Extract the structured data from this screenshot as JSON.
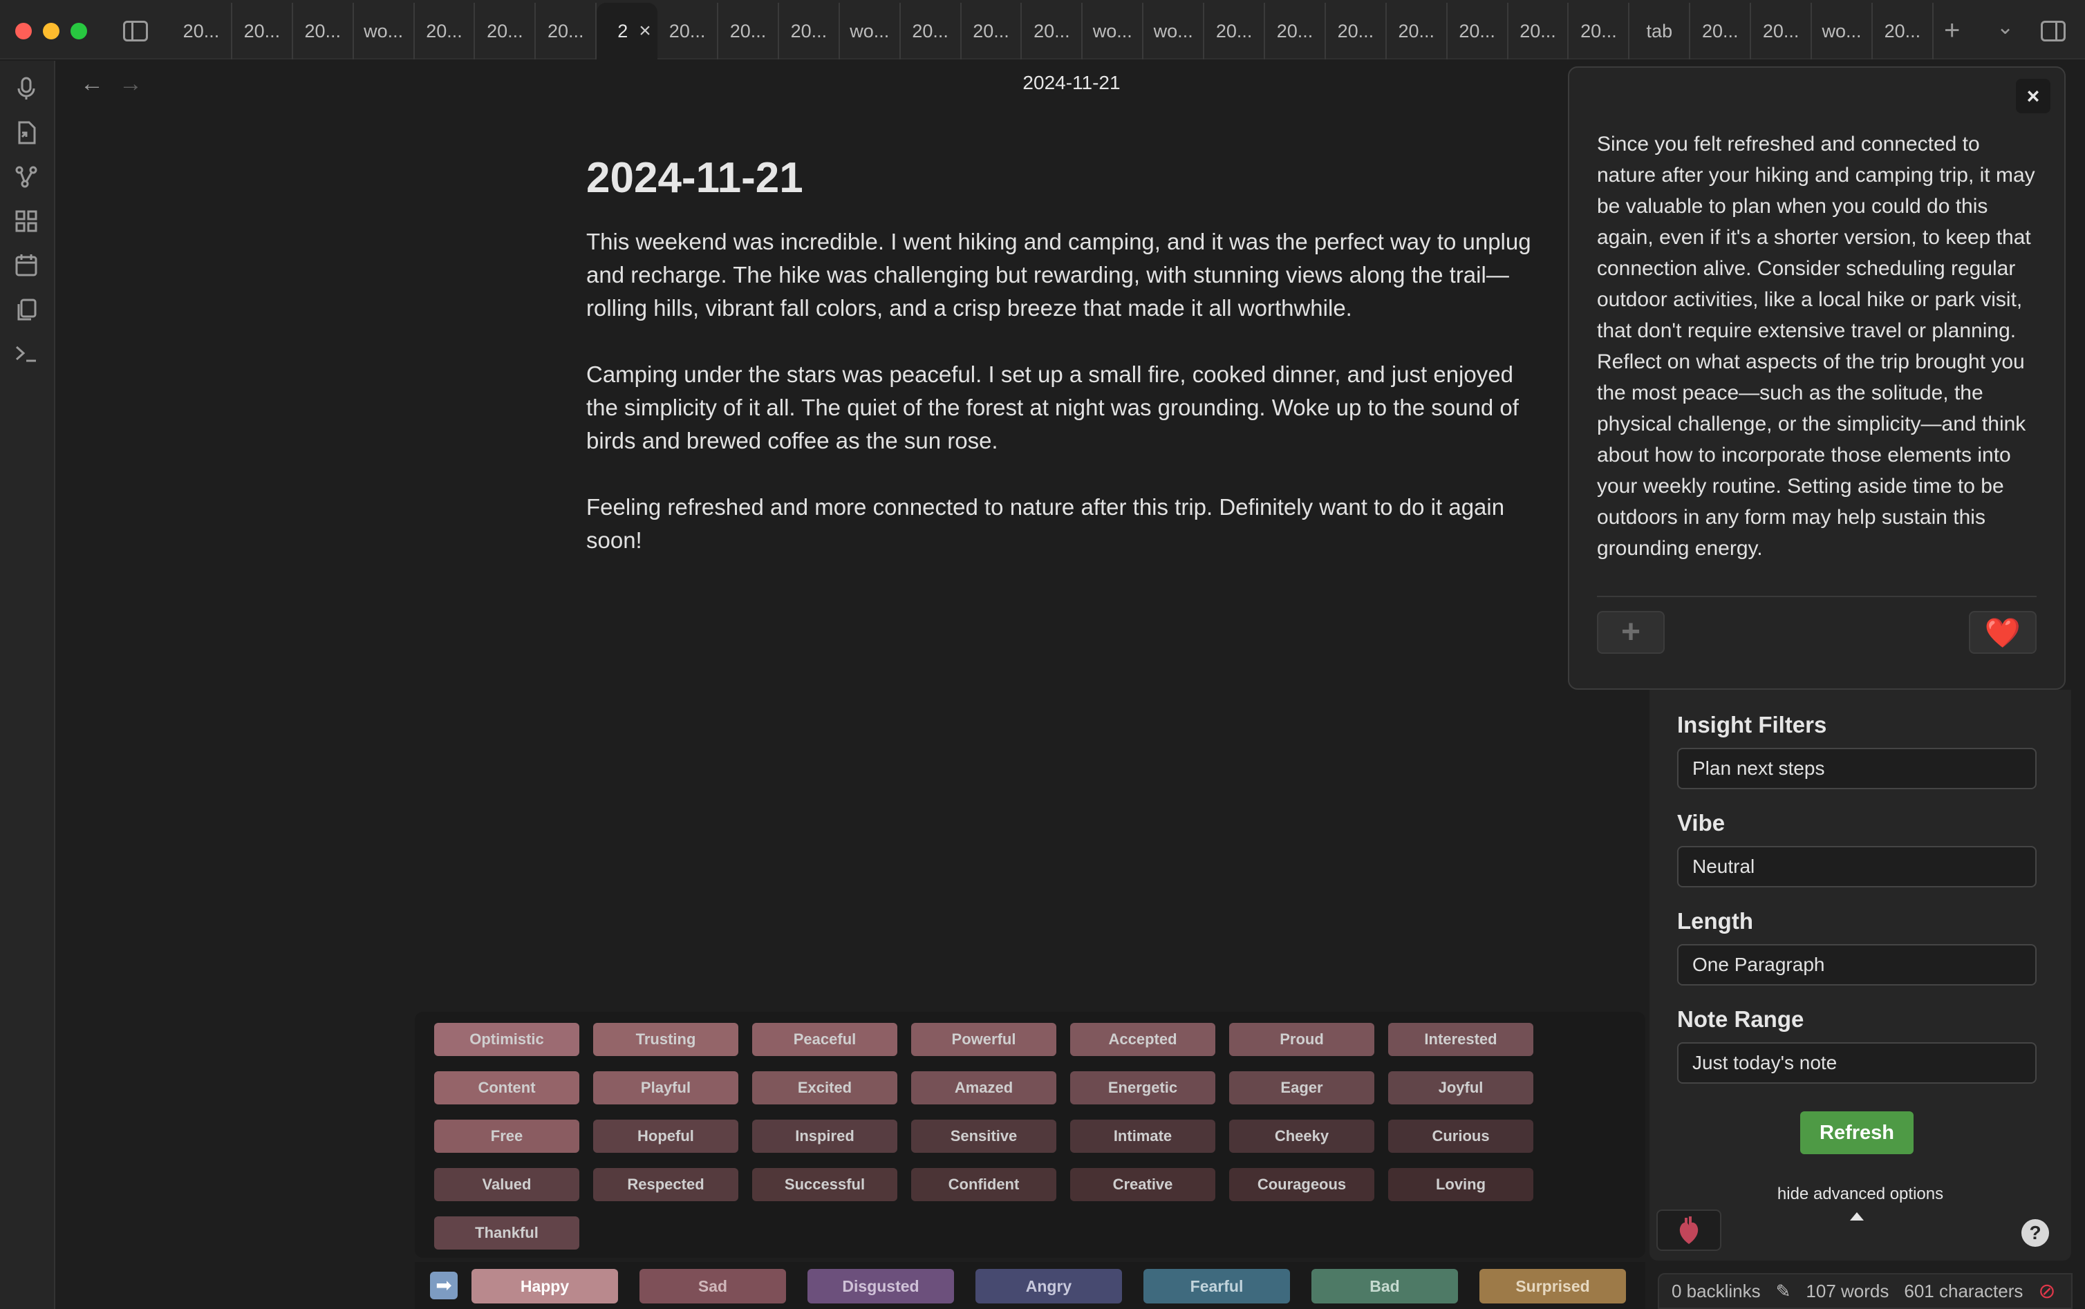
{
  "tabs": [
    "20...",
    "20...",
    "20...",
    "wo...",
    "20...",
    "20...",
    "20...",
    "2",
    "20...",
    "20...",
    "20...",
    "wo...",
    "20...",
    "20...",
    "20...",
    "wo...",
    "wo...",
    "20...",
    "20...",
    "20...",
    "20...",
    "20...",
    "20...",
    "20...",
    "tab",
    "20...",
    "20...",
    "wo...",
    "20..."
  ],
  "active_tab_index": 7,
  "view_title": "2024-11-21",
  "note": {
    "title": "2024-11-21",
    "paragraphs": [
      "This weekend was incredible. I went hiking and camping, and it was the perfect way to unplug and recharge. The hike was challenging but rewarding, with stunning views along the trail—rolling hills, vibrant fall colors, and a crisp breeze that made it all worthwhile.",
      "Camping under the stars was peaceful. I set up a small fire, cooked dinner, and just enjoyed the simplicity of it all. The quiet of the forest at night was grounding. Woke up to the sound of birds and brewed coffee as the sun rose.",
      "Feeling refreshed and more connected to nature after this trip. Definitely want to do it again soon!"
    ]
  },
  "insight": {
    "text": "Since you felt refreshed and connected to nature after your hiking and camping trip, it may be valuable to plan when you could do this again, even if it's a shorter version, to keep that connection alive. Consider scheduling regular outdoor activities, like a local hike or park visit, that don't require extensive travel or planning. Reflect on what aspects of the trip brought you the most peace—such as the solitude, the physical challenge, or the simplicity—and think about how to incorporate those elements into your weekly routine. Setting aside time to be outdoors in any form may help sustain this grounding energy.",
    "close_label": "×",
    "add_label": "+",
    "heart_label": "❤️"
  },
  "panel": {
    "insight_filters_label": "Insight Filters",
    "insight_filters_value": "Plan next steps",
    "vibe_label": "Vibe",
    "vibe_value": "Neutral",
    "length_label": "Length",
    "length_value": "One Paragraph",
    "note_range_label": "Note Range",
    "note_range_value": "Just today's note",
    "refresh_label": "Refresh",
    "hide_advanced_label": "hide advanced options",
    "help_label": "?"
  },
  "status": {
    "backlinks": "0 backlinks",
    "words": "107 words",
    "characters": "601 characters"
  },
  "emotions": [
    {
      "label": "Optimistic",
      "color": "#9c6b72"
    },
    {
      "label": "Trusting",
      "color": "#946569"
    },
    {
      "label": "Peaceful",
      "color": "#8e6065"
    },
    {
      "label": "Powerful",
      "color": "#875c61"
    },
    {
      "label": "Accepted",
      "color": "#80585d"
    },
    {
      "label": "Proud",
      "color": "#7a5459"
    },
    {
      "label": "Interested",
      "color": "#735055"
    },
    {
      "label": "Content",
      "color": "#956469"
    },
    {
      "label": "Playful",
      "color": "#8b5e63"
    },
    {
      "label": "Excited",
      "color": "#7f575b"
    },
    {
      "label": "Amazed",
      "color": "#765156"
    },
    {
      "label": "Energetic",
      "color": "#6d4b50"
    },
    {
      "label": "Eager",
      "color": "#67484c"
    },
    {
      "label": "Joyful",
      "color": "#614549"
    },
    {
      "label": "Free",
      "color": "#8a5c61"
    },
    {
      "label": "Hopeful",
      "color": "#5e4145"
    },
    {
      "label": "Inspired",
      "color": "#573d41"
    },
    {
      "label": "Sensitive",
      "color": "#51393c"
    },
    {
      "label": "Intimate",
      "color": "#4d3639"
    },
    {
      "label": "Cheeky",
      "color": "#4a3437"
    },
    {
      "label": "Curious",
      "color": "#473235"
    },
    {
      "label": "Valued",
      "color": "#5b3f43"
    },
    {
      "label": "Respected",
      "color": "#553b3e"
    },
    {
      "label": "Successful",
      "color": "#503739"
    },
    {
      "label": "Confident",
      "color": "#4b3436"
    },
    {
      "label": "Creative",
      "color": "#483133"
    },
    {
      "label": "Courageous",
      "color": "#452f31"
    },
    {
      "label": "Loving",
      "color": "#422d2f"
    },
    {
      "label": "Thankful",
      "color": "#624449"
    }
  ],
  "categories": [
    {
      "label": "Happy",
      "color": "#b9898d",
      "text_color": "#ffffff"
    },
    {
      "label": "Sad",
      "color": "#7e5058",
      "text_color": "#d0b8bb"
    },
    {
      "label": "Disgusted",
      "color": "#6c507c",
      "text_color": "#d0c2d8"
    },
    {
      "label": "Angry",
      "color": "#474a70",
      "text_color": "#c8c9dc"
    },
    {
      "label": "Fearful",
      "color": "#3f6a7e",
      "text_color": "#c2d4dc"
    },
    {
      "label": "Bad",
      "color": "#4e7a66",
      "text_color": "#c6dad0"
    },
    {
      "label": "Surprised",
      "color": "#9d7a48",
      "text_color": "#e6d8c0"
    }
  ]
}
